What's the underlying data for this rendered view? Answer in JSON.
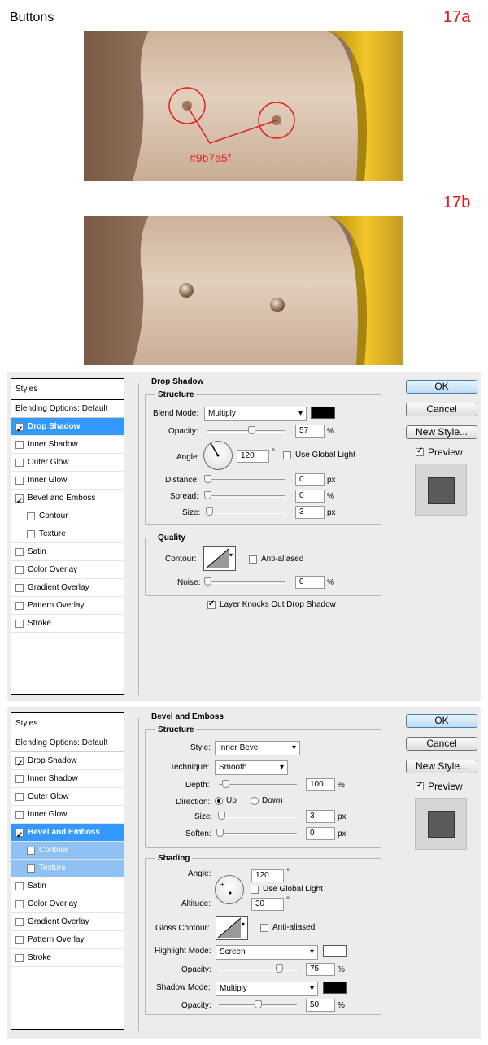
{
  "page": {
    "heading": "Buttons"
  },
  "steps": {
    "a": "17a",
    "b": "17b"
  },
  "image_a": {
    "annotation": "#9b7a5f"
  },
  "colors": {
    "accent_red": "#ee1111",
    "annotation_color": "#9b7a5f",
    "highlight": "#3399ff",
    "skin": "#d8c2ad"
  },
  "panel1": {
    "styles_header": "Styles",
    "blending": "Blending Options: Default",
    "items": [
      {
        "label": "Drop Shadow",
        "checked": true,
        "active": true
      },
      {
        "label": "Inner Shadow",
        "checked": false
      },
      {
        "label": "Outer Glow",
        "checked": false
      },
      {
        "label": "Inner Glow",
        "checked": false
      },
      {
        "label": "Bevel and Emboss",
        "checked": true
      },
      {
        "label": "Contour",
        "checked": false,
        "sub": true
      },
      {
        "label": "Texture",
        "checked": false,
        "sub": true
      },
      {
        "label": "Satin",
        "checked": false
      },
      {
        "label": "Color Overlay",
        "checked": false
      },
      {
        "label": "Gradient Overlay",
        "checked": false
      },
      {
        "label": "Pattern Overlay",
        "checked": false
      },
      {
        "label": "Stroke",
        "checked": false
      }
    ],
    "section": "Drop Shadow",
    "structure": "Structure",
    "blend_mode_label": "Blend Mode:",
    "blend_mode": "Multiply",
    "opacity_label": "Opacity:",
    "opacity": "57",
    "angle_label": "Angle:",
    "angle": "120",
    "degree": "°",
    "global_light": "Use Global Light",
    "distance_label": "Distance:",
    "distance": "0",
    "spread_label": "Spread:",
    "spread": "0",
    "size_label": "Size:",
    "size": "3",
    "quality": "Quality",
    "contour_label": "Contour:",
    "anti_aliased": "Anti-aliased",
    "noise_label": "Noise:",
    "noise": "0",
    "knockout": "Layer Knocks Out Drop Shadow",
    "unit_pct": "%",
    "unit_px": "px"
  },
  "panel2": {
    "styles_header": "Styles",
    "blending": "Blending Options: Default",
    "items": [
      {
        "label": "Drop Shadow",
        "checked": true
      },
      {
        "label": "Inner Shadow",
        "checked": false
      },
      {
        "label": "Outer Glow",
        "checked": false
      },
      {
        "label": "Inner Glow",
        "checked": false
      },
      {
        "label": "Bevel and Emboss",
        "checked": true,
        "active": true
      },
      {
        "label": "Contour",
        "checked": false,
        "sub": true,
        "subsel": true
      },
      {
        "label": "Texture",
        "checked": false,
        "sub": true,
        "subsel": true
      },
      {
        "label": "Satin",
        "checked": false
      },
      {
        "label": "Color Overlay",
        "checked": false
      },
      {
        "label": "Gradient Overlay",
        "checked": false
      },
      {
        "label": "Pattern Overlay",
        "checked": false
      },
      {
        "label": "Stroke",
        "checked": false
      }
    ],
    "section": "Bevel and Emboss",
    "structure": "Structure",
    "style_label": "Style:",
    "style": "Inner Bevel",
    "technique_label": "Technique:",
    "technique": "Smooth",
    "depth_label": "Depth:",
    "depth": "100",
    "direction_label": "Direction:",
    "dir_up": "Up",
    "dir_down": "Down",
    "size_label": "Size:",
    "size": "3",
    "soften_label": "Soften:",
    "soften": "0",
    "shading": "Shading",
    "angle_label": "Angle:",
    "angle": "120",
    "global_light": "Use Global Light",
    "altitude_label": "Altitude:",
    "altitude": "30",
    "degree": "°",
    "gloss_label": "Gloss Contour:",
    "anti_aliased": "Anti-aliased",
    "highlight_label": "Highlight Mode:",
    "highlight_mode": "Screen",
    "h_opacity_label": "Opacity:",
    "h_opacity": "75",
    "shadow_label": "Shadow Mode:",
    "shadow_mode": "Multiply",
    "s_opacity_label": "Opacity:",
    "s_opacity": "50",
    "unit_pct": "%",
    "unit_px": "px"
  },
  "buttons": {
    "ok": "OK",
    "cancel": "Cancel",
    "new_style": "New Style...",
    "preview": "Preview"
  }
}
